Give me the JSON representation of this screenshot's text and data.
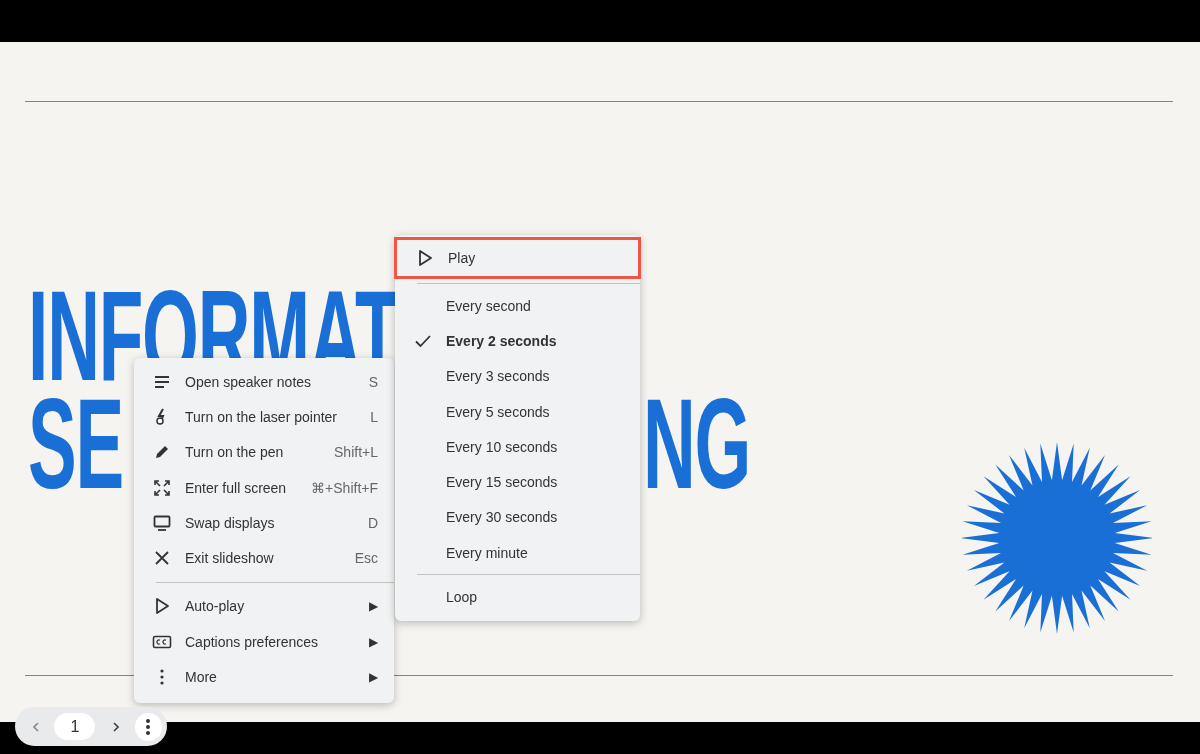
{
  "slide": {
    "title_lines": [
      [
        "INFORMAT"
      ],
      [
        "SE",
        "NG"
      ]
    ]
  },
  "menu": {
    "items": [
      {
        "kind": "action",
        "label": "Open speaker notes",
        "shortcut": "S"
      },
      {
        "kind": "action",
        "label": "Turn on the laser pointer",
        "shortcut": "L"
      },
      {
        "kind": "action",
        "label": "Turn on the pen",
        "shortcut": "Shift+L"
      },
      {
        "kind": "action",
        "label": "Enter full screen",
        "shortcut": "⌘+Shift+F"
      },
      {
        "kind": "action",
        "label": "Swap displays",
        "shortcut": "D"
      },
      {
        "kind": "action",
        "label": "Exit slideshow",
        "shortcut": "Esc"
      },
      {
        "kind": "divider"
      },
      {
        "kind": "submenu",
        "label": "Auto-play",
        "arrow": "▶"
      },
      {
        "kind": "submenu",
        "label": "Captions preferences",
        "arrow": "▶"
      },
      {
        "kind": "submenu",
        "label": "More",
        "arrow": "▶"
      }
    ]
  },
  "submenu": {
    "items": [
      {
        "kind": "play",
        "label": "Play",
        "highlighted": true
      },
      {
        "kind": "divider"
      },
      {
        "kind": "option",
        "label": "Every second",
        "checked": false
      },
      {
        "kind": "option",
        "label": "Every 2 seconds",
        "checked": true
      },
      {
        "kind": "option",
        "label": "Every 3 seconds",
        "checked": false
      },
      {
        "kind": "option",
        "label": "Every 5 seconds",
        "checked": false
      },
      {
        "kind": "option",
        "label": "Every 10 seconds",
        "checked": false
      },
      {
        "kind": "option",
        "label": "Every 15 seconds",
        "checked": false
      },
      {
        "kind": "option",
        "label": "Every 30 seconds",
        "checked": false
      },
      {
        "kind": "option",
        "label": "Every minute",
        "checked": false
      },
      {
        "kind": "divider"
      },
      {
        "kind": "option",
        "label": "Loop",
        "checked": false
      }
    ]
  },
  "navigator": {
    "page": "1"
  }
}
